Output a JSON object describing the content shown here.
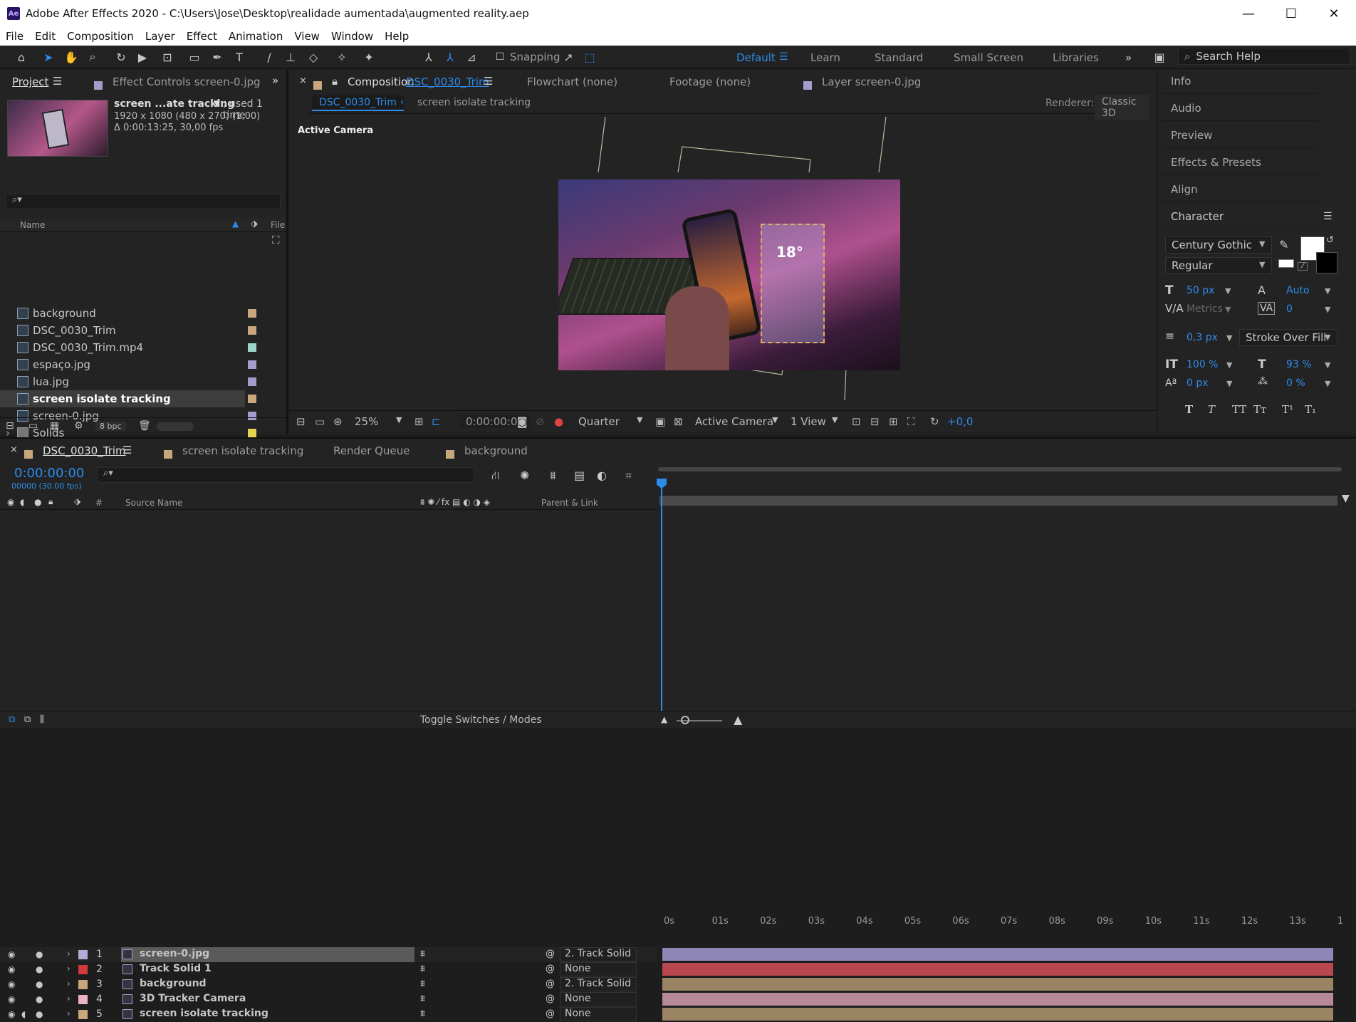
{
  "window": {
    "title": "Adobe After Effects 2020 - C:\\Users\\Jose\\Desktop\\realidade aumentada\\augmented reality.aep",
    "app_icon": "Ae",
    "minimize": "—",
    "maximize": "☐",
    "close": "✕"
  },
  "menu": [
    "File",
    "Edit",
    "Composition",
    "Layer",
    "Effect",
    "Animation",
    "View",
    "Window",
    "Help"
  ],
  "toolbar": {
    "snapping_label": "Snapping",
    "workspaces": [
      "Default",
      "Learn",
      "Standard",
      "Small Screen",
      "Libraries"
    ],
    "active_workspace": "Default",
    "search_placeholder": "Search Help"
  },
  "project": {
    "tab_label": "Project",
    "effect_controls_tab": "Effect Controls screen-0.jpg",
    "selected_name": "screen ...ate tracking",
    "used": ", used 1 time",
    "dims": "1920 x 1080  (480 x 270) (1,00)",
    "duration": "Δ 0:00:13:25, 30,00 fps",
    "col_name": "Name",
    "col_file": "File",
    "bpc": "8 bpc",
    "items": [
      {
        "name": "background",
        "color": "#c7a77b"
      },
      {
        "name": "DSC_0030_Trim",
        "color": "#c7a77b"
      },
      {
        "name": "DSC_0030_Trim.mp4",
        "color": "#9fd3c7"
      },
      {
        "name": "espaço.jpg",
        "color": "#a59ccd"
      },
      {
        "name": "lua.jpg",
        "color": "#a59ccd"
      },
      {
        "name": "screen isolate tracking",
        "color": "#c7a77b"
      },
      {
        "name": "screen-0.jpg",
        "color": "#a59ccd"
      },
      {
        "name": "Solids",
        "color": "#e4d34c"
      }
    ]
  },
  "viewer": {
    "comp_tab": "Composition",
    "comp_name": "DSC_0030_Trim",
    "flowchart_tab": "Flowchart (none)",
    "footage_tab": "Footage (none)",
    "layer_tab": "Layer screen-0.jpg",
    "breadcrumb_active": "DSC_0030_Trim",
    "breadcrumb_other": "screen isolate tracking",
    "renderer_label": "Renderer:",
    "renderer_value": "Classic 3D",
    "camera_label": "Active Camera",
    "overlay_temp": "18°",
    "zoom": "25%",
    "timecode": "0:00:00:00",
    "resolution": "Quarter",
    "camera_select": "Active Camera",
    "views": "1 View",
    "exposure": "+0,0"
  },
  "right_panels": {
    "items": [
      "Info",
      "Audio",
      "Preview",
      "Effects & Presets",
      "Align"
    ]
  },
  "character": {
    "title": "Character",
    "font": "Century Gothic",
    "style": "Regular",
    "size": "50 px",
    "leading": "Auto",
    "kerning": "Metrics",
    "tracking": "0",
    "stroke_width": "0,3 px",
    "stroke_mode": "Stroke Over Fill",
    "vscale": "100 %",
    "hscale": "93 %",
    "baseline": "0 px",
    "tsume": "0 %",
    "styles": [
      "T",
      "T",
      "TT",
      "Tт",
      "T¹",
      "T₁"
    ]
  },
  "timeline": {
    "tabs": [
      "DSC_0030_Trim",
      "screen isolate tracking",
      "Render Queue",
      "background"
    ],
    "timecode": "0:00:00:00",
    "frame": "00000 (30.00 fps)",
    "col_hash": "#",
    "col_source": "Source Name",
    "col_parent": "Parent & Link",
    "ruler": [
      "0s",
      "01s",
      "02s",
      "03s",
      "04s",
      "05s",
      "06s",
      "07s",
      "08s",
      "09s",
      "10s",
      "11s",
      "12s",
      "13s",
      "1"
    ],
    "layers": [
      {
        "num": "1",
        "name": "screen-0.jpg",
        "label": "#b3abd8",
        "parent": "2. Track Solid",
        "bar": "#8f86b8"
      },
      {
        "num": "2",
        "name": "Track Solid 1",
        "label": "#d43a3a",
        "parent": "None",
        "bar": "#b8474f"
      },
      {
        "num": "3",
        "name": "background",
        "label": "#c7a77b",
        "parent": "2. Track Solid",
        "bar": "#9a8463"
      },
      {
        "num": "4",
        "name": "3D Tracker Camera",
        "label": "#e9b4c4",
        "parent": "None",
        "bar": "#b88999"
      },
      {
        "num": "5",
        "name": "screen isolate tracking",
        "label": "#c7a77b",
        "parent": "None",
        "bar": "#9a8463"
      }
    ],
    "toggle_label": "Toggle Switches / Modes"
  }
}
